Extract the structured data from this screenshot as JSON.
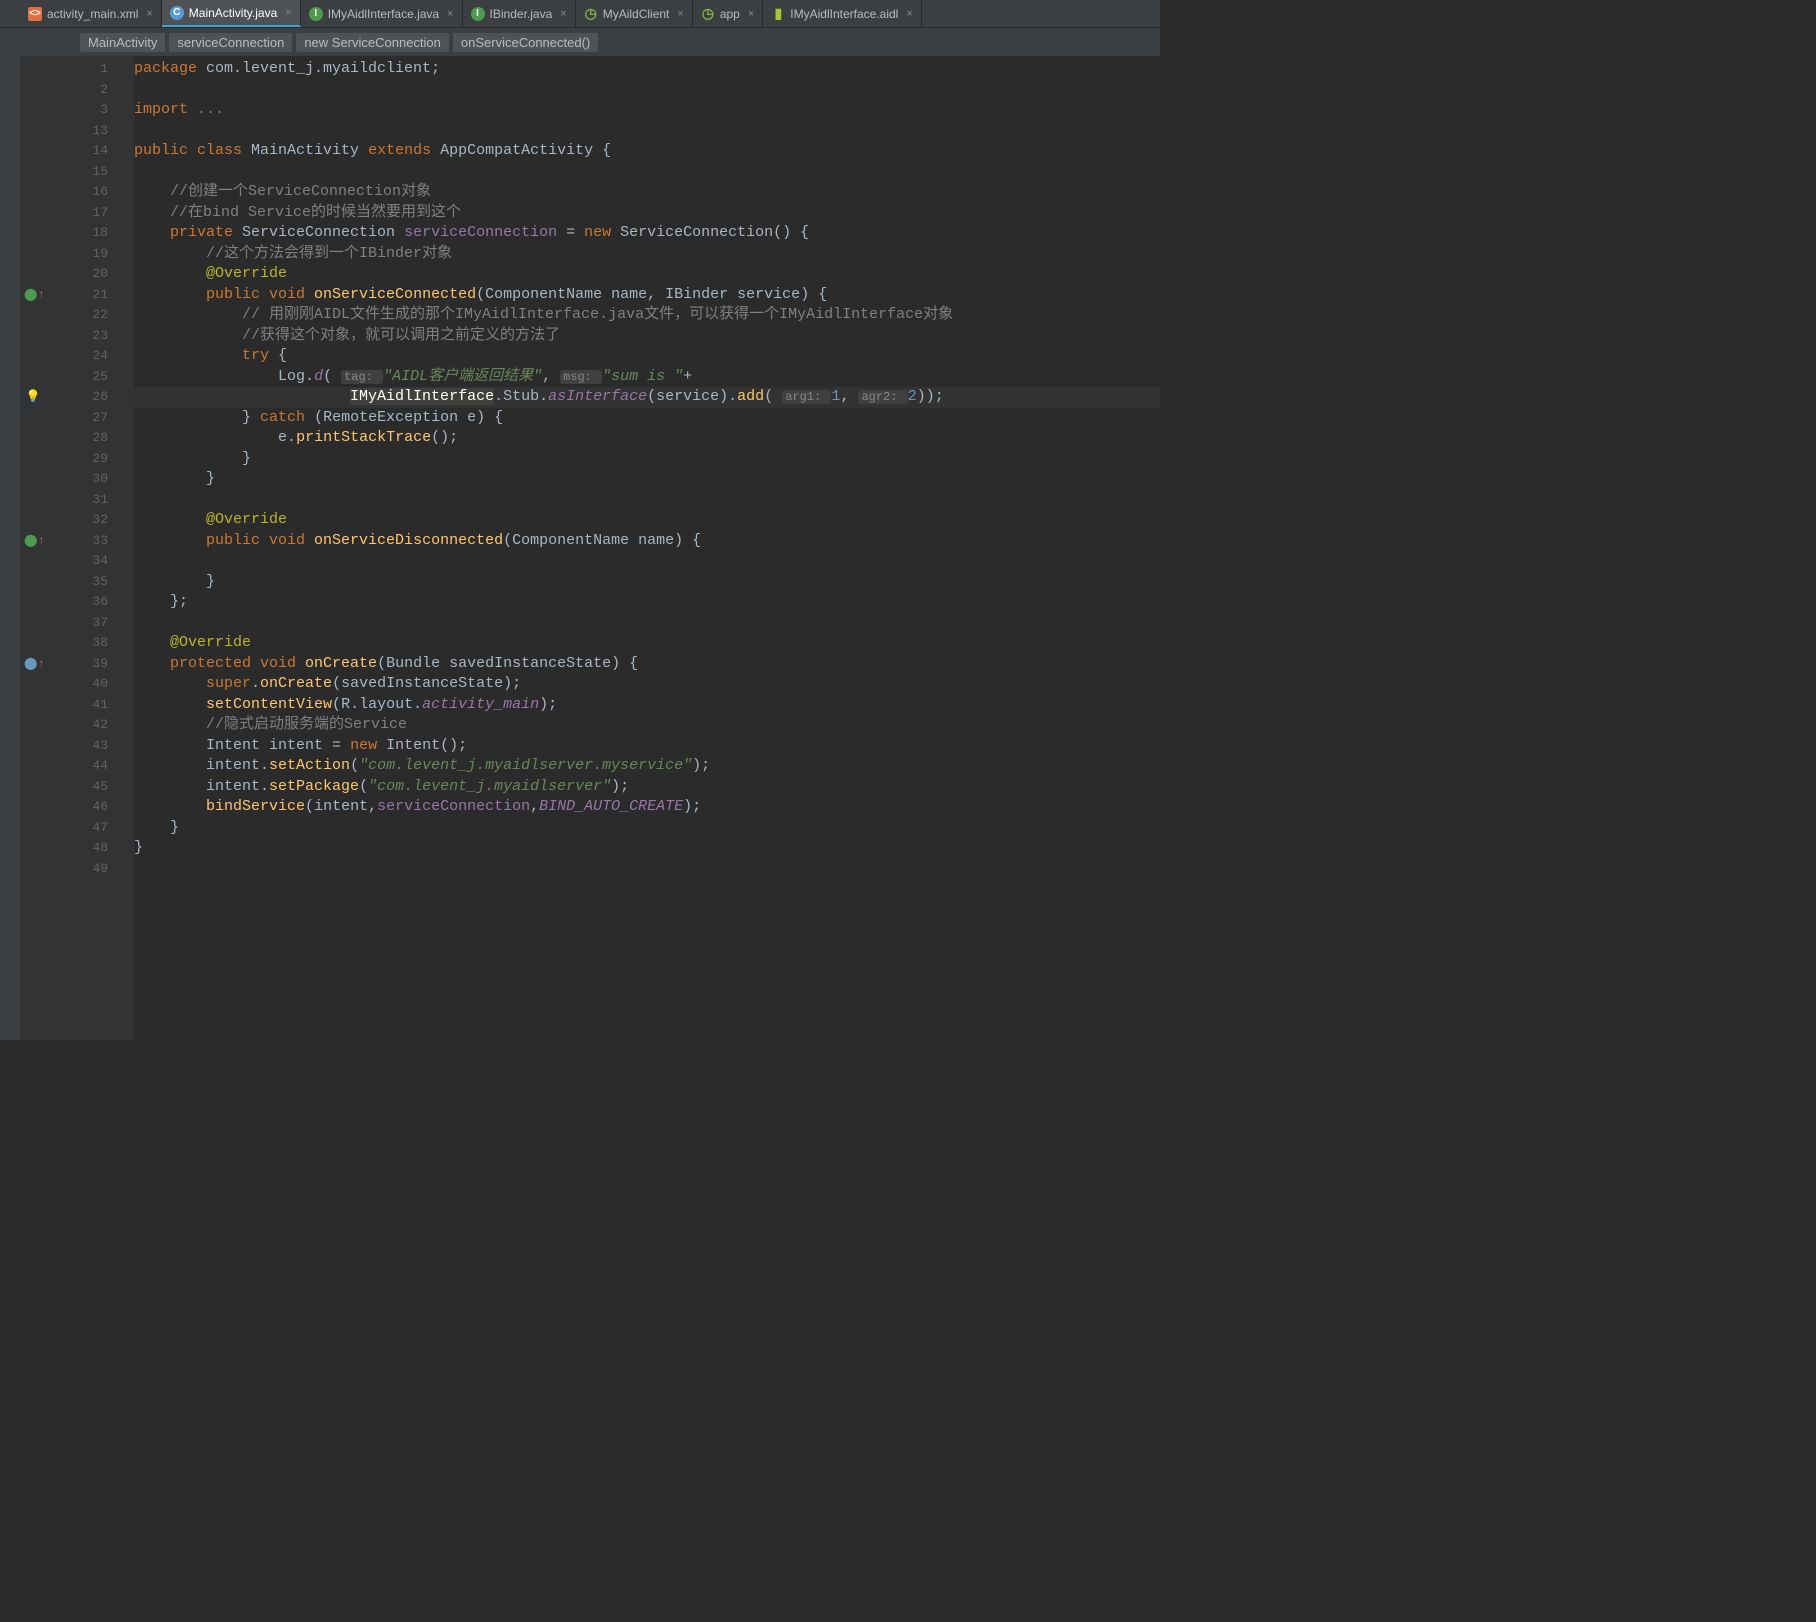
{
  "tabs": [
    {
      "icon": "xml",
      "label": "activity_main.xml"
    },
    {
      "icon": "java-c",
      "label": "MainActivity.java",
      "active": true
    },
    {
      "icon": "java-i",
      "label": "IMyAidlInterface.java"
    },
    {
      "icon": "java-i",
      "label": "IBinder.java"
    },
    {
      "icon": "app",
      "label": "MyAildClient"
    },
    {
      "icon": "app",
      "label": "app"
    },
    {
      "icon": "aidl",
      "label": "IMyAidlInterface.aidl"
    }
  ],
  "breadcrumbs": [
    "MainActivity",
    "serviceConnection",
    "new ServiceConnection",
    "onServiceConnected()"
  ],
  "line_numbers": [
    "1",
    "2",
    "3",
    "13",
    "14",
    "15",
    "16",
    "17",
    "18",
    "19",
    "20",
    "21",
    "22",
    "23",
    "24",
    "25",
    "26",
    "27",
    "28",
    "29",
    "30",
    "31",
    "32",
    "33",
    "34",
    "35",
    "36",
    "37",
    "38",
    "39",
    "40",
    "41",
    "42",
    "43",
    "44",
    "45",
    "46",
    "47",
    "48",
    "49"
  ],
  "gutter_marks": {
    "line21": "⬤↑",
    "line26": "💡",
    "line33": "⬤↑",
    "line39": "⬤↑"
  },
  "code": {
    "l1": {
      "pre": "",
      "t": [
        [
          "kw",
          "package "
        ],
        [
          "pkg",
          "com.levent_j.myaildclient"
        ],
        [
          "",
          ";"
        ]
      ]
    },
    "l2": {
      "pre": "",
      "t": []
    },
    "l3": {
      "pre": "",
      "t": [
        [
          "kw",
          "import "
        ],
        [
          "comment",
          "..."
        ]
      ]
    },
    "l13": {
      "pre": "",
      "t": []
    },
    "l14": {
      "pre": "",
      "t": [
        [
          "kw",
          "public class "
        ],
        [
          "classname",
          "MainActivity "
        ],
        [
          "kw",
          "extends "
        ],
        [
          "classname",
          "AppCompatActivity "
        ],
        [
          "",
          "{"
        ]
      ]
    },
    "l15": {
      "pre": "",
      "t": []
    },
    "l16": {
      "pre": "    ",
      "t": [
        [
          "comment",
          "//创建一个ServiceConnection对象"
        ]
      ]
    },
    "l17": {
      "pre": "    ",
      "t": [
        [
          "comment",
          "//在bind Service的时候当然要用到这个"
        ]
      ]
    },
    "l18": {
      "pre": "    ",
      "t": [
        [
          "kw",
          "private "
        ],
        [
          "classname",
          "ServiceConnection "
        ],
        [
          "field",
          "serviceConnection "
        ],
        [
          "",
          "= "
        ],
        [
          "kw",
          "new "
        ],
        [
          "classname",
          "ServiceConnection"
        ],
        [
          "",
          "() {"
        ]
      ]
    },
    "l19": {
      "pre": "        ",
      "t": [
        [
          "comment",
          "//这个方法会得到一个IBinder对象"
        ]
      ]
    },
    "l20": {
      "pre": "        ",
      "t": [
        [
          "annotation",
          "@Override"
        ]
      ]
    },
    "l21": {
      "pre": "        ",
      "t": [
        [
          "kw",
          "public void "
        ],
        [
          "method-def",
          "onServiceConnected"
        ],
        [
          "",
          "("
        ],
        [
          "classname",
          "ComponentName "
        ],
        [
          "var",
          "name"
        ],
        [
          "",
          ", "
        ],
        [
          "classname",
          "IBinder "
        ],
        [
          "var",
          "service"
        ],
        [
          "",
          ") {"
        ]
      ]
    },
    "l22": {
      "pre": "            ",
      "t": [
        [
          "comment",
          "// 用刚刚AIDL文件生成的那个IMyAidlInterface.java文件，可以获得一个IMyAidlInterface对象"
        ]
      ]
    },
    "l23": {
      "pre": "            ",
      "t": [
        [
          "comment",
          "//获得这个对象，就可以调用之前定义的方法了"
        ]
      ]
    },
    "l24": {
      "pre": "            ",
      "t": [
        [
          "kw",
          "try "
        ],
        [
          "",
          "{"
        ]
      ]
    },
    "l25": {
      "pre": "                ",
      "t": [
        [
          "classname",
          "Log"
        ],
        [
          "",
          "."
        ],
        [
          "static",
          "d"
        ],
        [
          "",
          "( "
        ],
        [
          "hint",
          "tag: "
        ],
        [
          "string-i",
          "\"AIDL客户端返回结果\""
        ],
        [
          "",
          ", "
        ],
        [
          "hint",
          "msg: "
        ],
        [
          "string-i",
          "\"sum is \""
        ],
        [
          "",
          "+"
        ]
      ]
    },
    "l26": {
      "pre": "                        ",
      "t": [
        [
          "highlighted-ref",
          "IMyAidlInterface"
        ],
        [
          "",
          ".Stub."
        ],
        [
          "static",
          "asInterface"
        ],
        [
          "",
          "("
        ],
        [
          "var",
          "service"
        ],
        [
          "",
          ")."
        ],
        [
          "method",
          "add"
        ],
        [
          "",
          "( "
        ],
        [
          "hint",
          "arg1: "
        ],
        [
          "number",
          "1"
        ],
        [
          "",
          ", "
        ],
        [
          "hint",
          "agr2: "
        ],
        [
          "number",
          "2"
        ],
        [
          "",
          "));"
        ]
      ]
    },
    "l27": {
      "pre": "            ",
      "t": [
        [
          "",
          "} "
        ],
        [
          "kw",
          "catch "
        ],
        [
          "",
          "("
        ],
        [
          "classname",
          "RemoteException "
        ],
        [
          "var",
          "e"
        ],
        [
          "",
          ") {"
        ]
      ]
    },
    "l28": {
      "pre": "                ",
      "t": [
        [
          "var",
          "e"
        ],
        [
          "",
          "."
        ],
        [
          "method",
          "printStackTrace"
        ],
        [
          "",
          "();"
        ]
      ]
    },
    "l29": {
      "pre": "            ",
      "t": [
        [
          "",
          "}"
        ]
      ]
    },
    "l30": {
      "pre": "        ",
      "t": [
        [
          "",
          "}"
        ]
      ]
    },
    "l31": {
      "pre": "",
      "t": []
    },
    "l32": {
      "pre": "        ",
      "t": [
        [
          "annotation",
          "@Override"
        ]
      ]
    },
    "l33": {
      "pre": "        ",
      "t": [
        [
          "kw",
          "public void "
        ],
        [
          "method-def",
          "onServiceDisconnected"
        ],
        [
          "",
          "("
        ],
        [
          "classname",
          "ComponentName "
        ],
        [
          "var",
          "name"
        ],
        [
          "",
          ") {"
        ]
      ]
    },
    "l34": {
      "pre": "",
      "t": []
    },
    "l35": {
      "pre": "        ",
      "t": [
        [
          "",
          "}"
        ]
      ]
    },
    "l36": {
      "pre": "    ",
      "t": [
        [
          "",
          "};"
        ]
      ]
    },
    "l37": {
      "pre": "",
      "t": []
    },
    "l38": {
      "pre": "    ",
      "t": [
        [
          "annotation",
          "@Override"
        ]
      ]
    },
    "l39": {
      "pre": "    ",
      "t": [
        [
          "kw",
          "protected void "
        ],
        [
          "method-def",
          "onCreate"
        ],
        [
          "",
          "("
        ],
        [
          "classname",
          "Bundle "
        ],
        [
          "var",
          "savedInstanceState"
        ],
        [
          "",
          ") {"
        ]
      ]
    },
    "l40": {
      "pre": "        ",
      "t": [
        [
          "kw",
          "super"
        ],
        [
          "",
          "."
        ],
        [
          "method",
          "onCreate"
        ],
        [
          "",
          "("
        ],
        [
          "var",
          "savedInstanceState"
        ],
        [
          "",
          ");"
        ]
      ]
    },
    "l41": {
      "pre": "        ",
      "t": [
        [
          "method",
          "setContentView"
        ],
        [
          "",
          "("
        ],
        [
          "classname",
          "R"
        ],
        [
          "",
          ".layout."
        ],
        [
          "static",
          "activity_main"
        ],
        [
          "",
          ");"
        ]
      ]
    },
    "l42": {
      "pre": "        ",
      "t": [
        [
          "comment",
          "//隐式启动服务端的Service"
        ]
      ]
    },
    "l43": {
      "pre": "        ",
      "t": [
        [
          "classname",
          "Intent "
        ],
        [
          "var",
          "intent "
        ],
        [
          "",
          "= "
        ],
        [
          "kw",
          "new "
        ],
        [
          "classname",
          "Intent"
        ],
        [
          "",
          "();"
        ]
      ]
    },
    "l44": {
      "pre": "        ",
      "t": [
        [
          "var",
          "intent"
        ],
        [
          "",
          "."
        ],
        [
          "method",
          "setAction"
        ],
        [
          "",
          "("
        ],
        [
          "string-i",
          "\"com.levent_j.myaidlserver.myservice\""
        ],
        [
          "",
          ");"
        ]
      ]
    },
    "l45": {
      "pre": "        ",
      "t": [
        [
          "var",
          "intent"
        ],
        [
          "",
          "."
        ],
        [
          "method",
          "setPackage"
        ],
        [
          "",
          "("
        ],
        [
          "string-i",
          "\"com.levent_j.myaidlserver\""
        ],
        [
          "",
          ");"
        ]
      ]
    },
    "l46": {
      "pre": "        ",
      "t": [
        [
          "method",
          "bindService"
        ],
        [
          "",
          "("
        ],
        [
          "var",
          "intent"
        ],
        [
          "",
          ","
        ],
        [
          "field",
          "serviceConnection"
        ],
        [
          "",
          ","
        ],
        [
          "const",
          "BIND_AUTO_CREATE"
        ],
        [
          "",
          ");"
        ]
      ]
    },
    "l47": {
      "pre": "    ",
      "t": [
        [
          "",
          "}"
        ]
      ]
    },
    "l48": {
      "pre": "",
      "t": [
        [
          "",
          "}"
        ]
      ]
    },
    "l49": {
      "pre": "",
      "t": []
    }
  }
}
